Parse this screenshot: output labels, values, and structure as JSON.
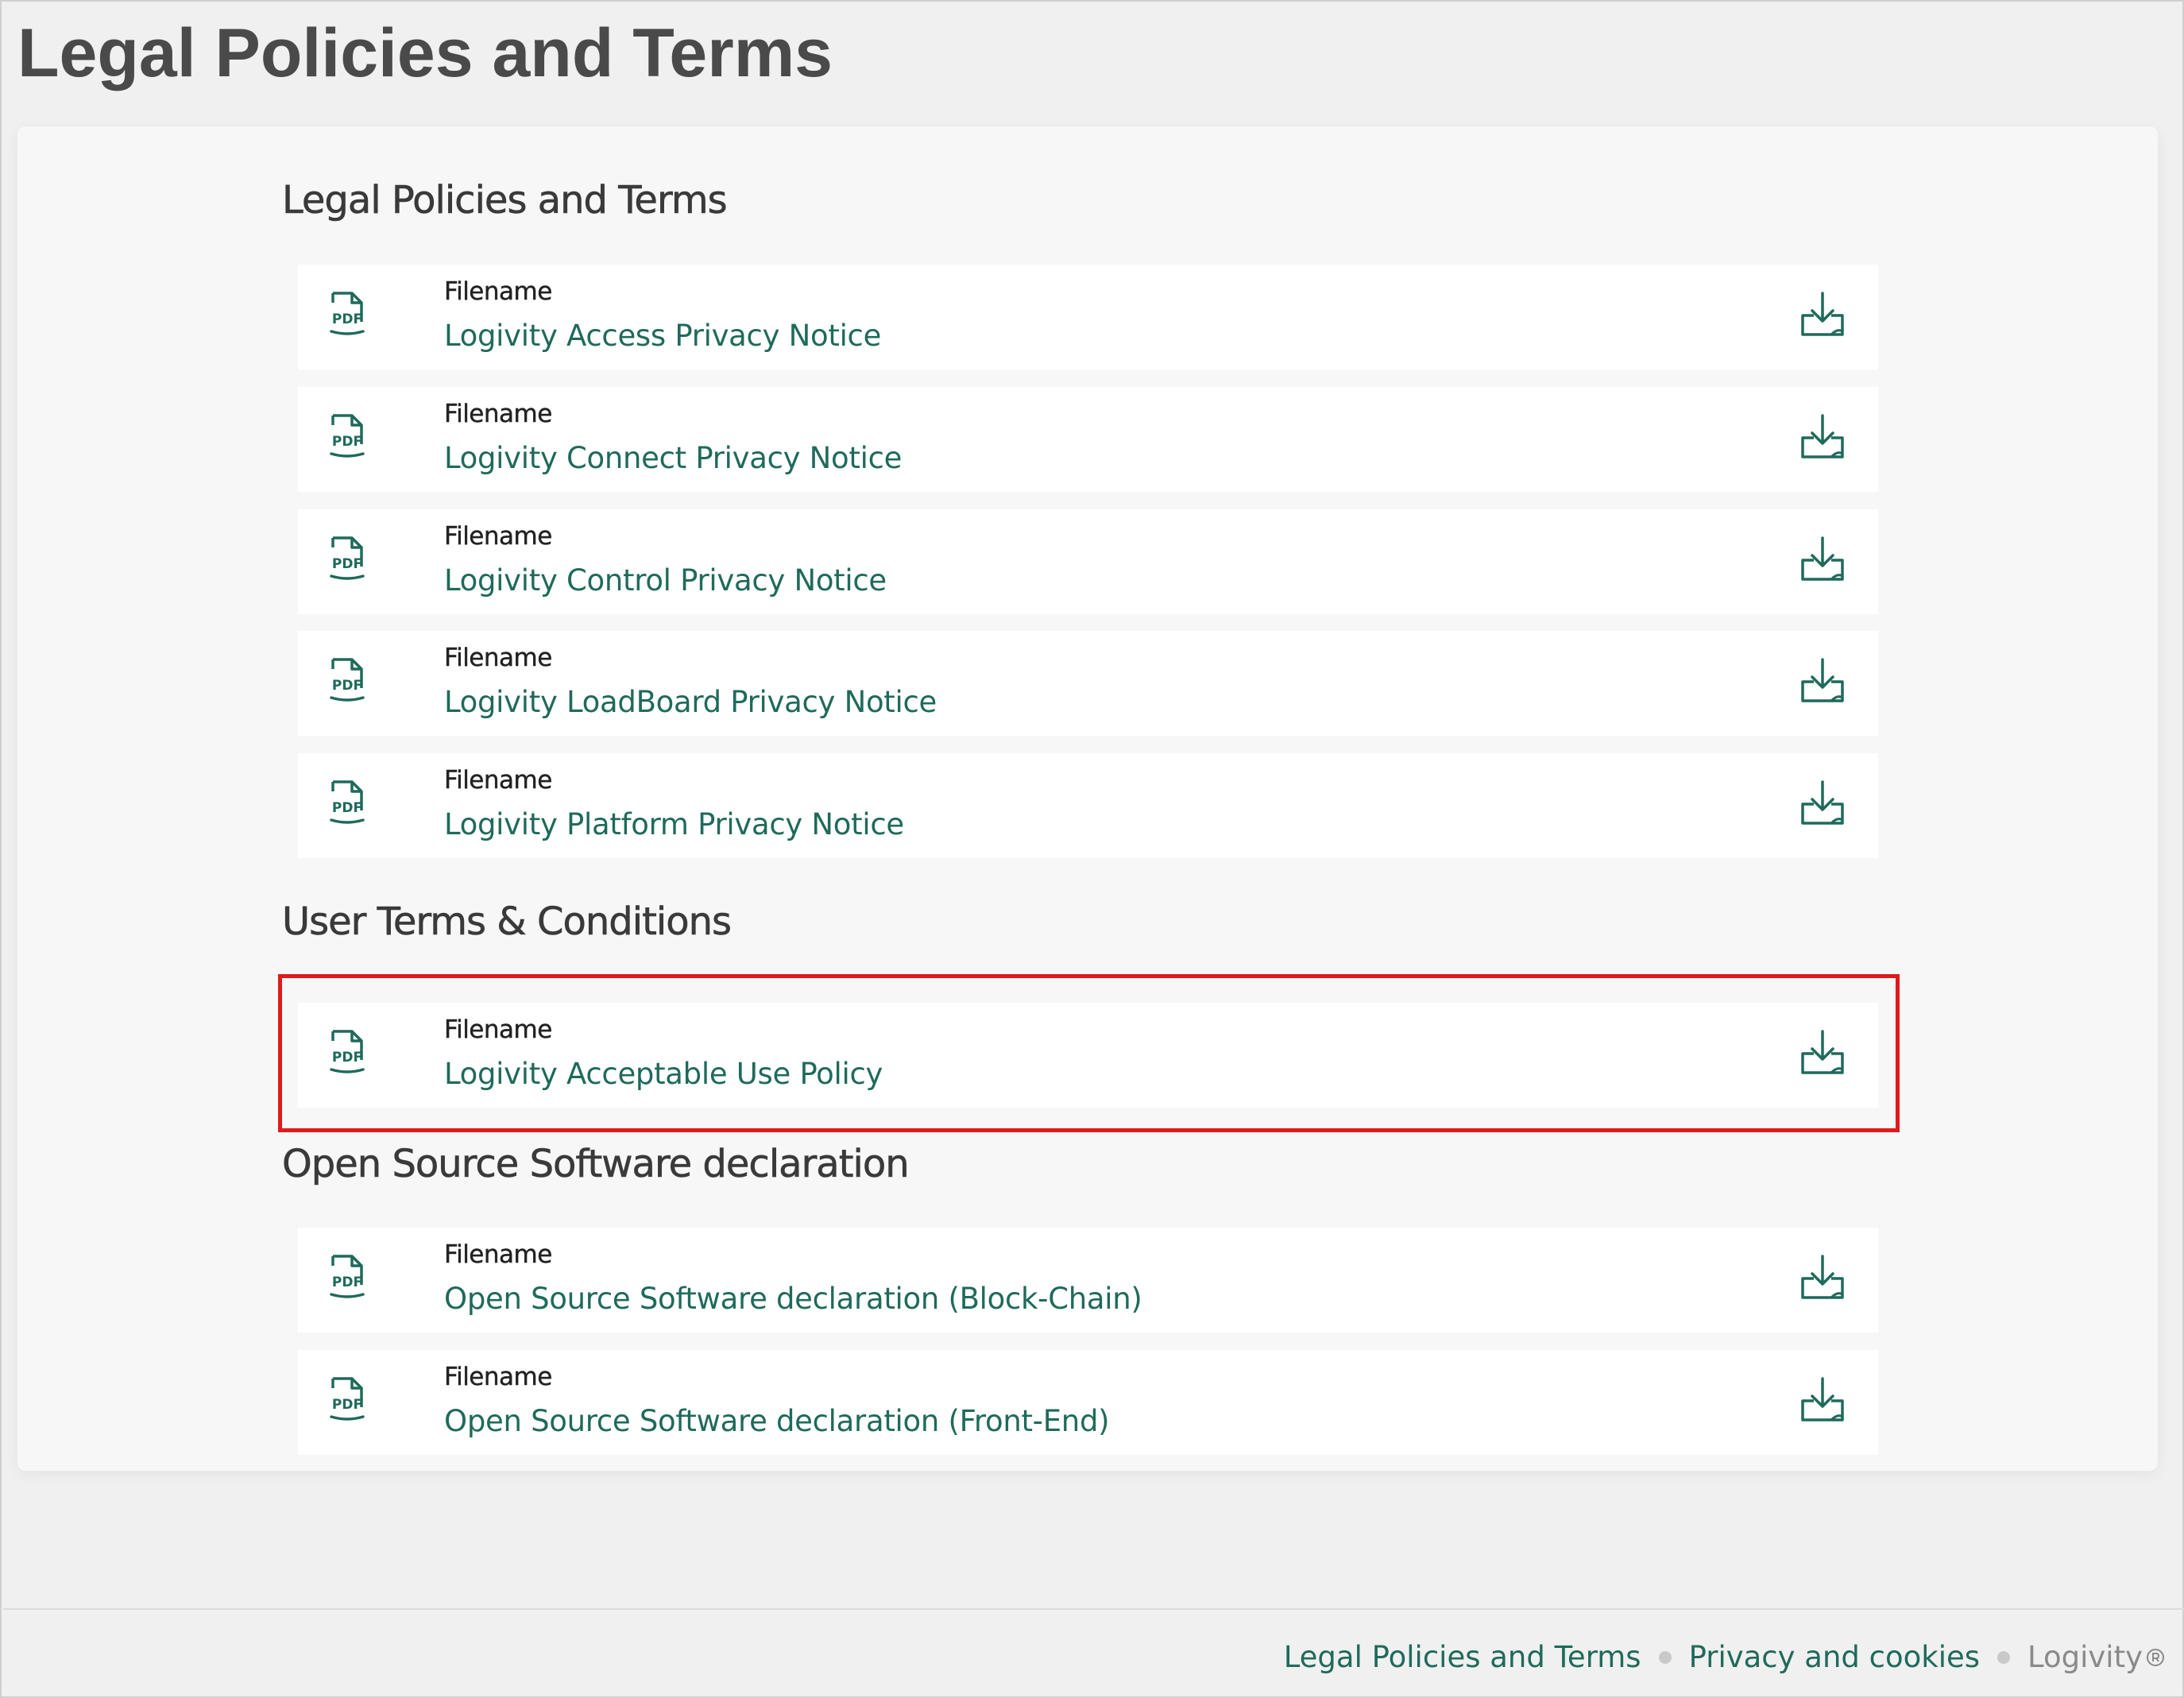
{
  "page": {
    "title": "Legal Policies and Terms"
  },
  "sections": [
    {
      "heading": "Legal Policies and Terms",
      "files": [
        {
          "label": "Filename",
          "name": "Logivity Access Privacy Notice"
        },
        {
          "label": "Filename",
          "name": "Logivity Connect Privacy Notice"
        },
        {
          "label": "Filename",
          "name": "Logivity Control Privacy Notice"
        },
        {
          "label": "Filename",
          "name": "Logivity LoadBoard Privacy Notice"
        },
        {
          "label": "Filename",
          "name": "Logivity Platform Privacy Notice"
        }
      ]
    },
    {
      "heading": "User Terms & Conditions",
      "files": [
        {
          "label": "Filename",
          "name": "Logivity Acceptable Use Policy"
        }
      ]
    },
    {
      "heading": "Open Source Software declaration",
      "files": [
        {
          "label": "Filename",
          "name": "Open Source Software declaration (Block-Chain)"
        },
        {
          "label": "Filename",
          "name": "Open Source Software declaration (Front-End)"
        }
      ]
    }
  ],
  "icons": {
    "file": "pdf-file-icon",
    "download": "download-icon",
    "pdf_badge": "PDF"
  },
  "footer": {
    "links": [
      "Legal Policies and Terms",
      "Privacy and cookies"
    ],
    "brand": "Logivity"
  },
  "colors": {
    "accent": "#1f6a5b",
    "highlight": "#e01a1a"
  }
}
